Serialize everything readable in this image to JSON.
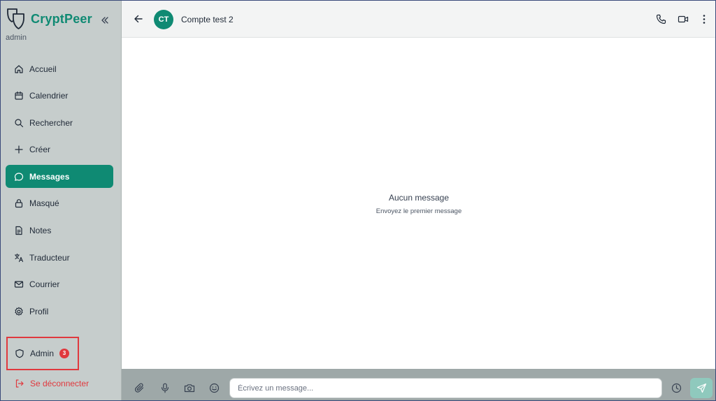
{
  "app": {
    "name": "CryptPeer",
    "role": "admin"
  },
  "sidebar": {
    "items": [
      {
        "label": "Accueil",
        "icon": "home-icon"
      },
      {
        "label": "Calendrier",
        "icon": "calendar-icon"
      },
      {
        "label": "Rechercher",
        "icon": "search-icon"
      },
      {
        "label": "Créer",
        "icon": "plus-icon"
      },
      {
        "label": "Messages",
        "icon": "message-icon",
        "active": true
      },
      {
        "label": "Masqué",
        "icon": "lock-icon"
      },
      {
        "label": "Notes",
        "icon": "note-icon"
      },
      {
        "label": "Traducteur",
        "icon": "translate-icon"
      },
      {
        "label": "Courrier",
        "icon": "mail-icon"
      },
      {
        "label": "Profil",
        "icon": "gear-icon"
      }
    ],
    "admin": {
      "label": "Admin",
      "badge": "3",
      "icon": "shield-icon"
    },
    "logout": {
      "label": "Se déconnecter",
      "icon": "logout-icon"
    }
  },
  "chat": {
    "avatar_initials": "CT",
    "contact_name": "Compte test 2",
    "empty_title": "Aucun message",
    "empty_subtitle": "Envoyez le premier message"
  },
  "composer": {
    "placeholder": "Écrivez un message..."
  },
  "colors": {
    "accent": "#0f8a73",
    "sidebar_bg": "#c6cdcc",
    "danger": "#e0393e",
    "composer_bg": "#9ea8a8",
    "send_button": "#8fc9bd"
  }
}
